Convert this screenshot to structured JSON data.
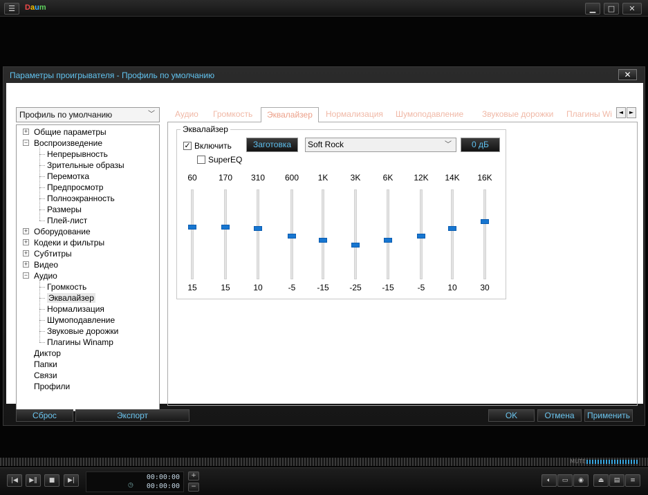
{
  "app": {
    "logo": "Daum",
    "window_icon": "menu-icon",
    "window_buttons": [
      "minimize-icon",
      "restore-icon",
      "close-icon"
    ]
  },
  "dialog": {
    "title": "Параметры проигрывателя - Профиль по умолчанию",
    "close_label": "✕",
    "profile_select": "Профиль по умолчанию",
    "tree": [
      {
        "label": "Общие параметры",
        "level": 0,
        "expander": "+"
      },
      {
        "label": "Воспроизведение",
        "level": 0,
        "expander": "−"
      },
      {
        "label": "Непрерывность",
        "level": 1
      },
      {
        "label": "Зрительные образы",
        "level": 1
      },
      {
        "label": "Перемотка",
        "level": 1
      },
      {
        "label": "Предпросмотр",
        "level": 1
      },
      {
        "label": "Полноэкранность",
        "level": 1
      },
      {
        "label": "Размеры",
        "level": 1
      },
      {
        "label": "Плей-лист",
        "level": 1
      },
      {
        "label": "Оборудование",
        "level": 0,
        "expander": "+"
      },
      {
        "label": "Кодеки и фильтры",
        "level": 0,
        "expander": "+"
      },
      {
        "label": "Субтитры",
        "level": 0,
        "expander": "+"
      },
      {
        "label": "Видео",
        "level": 0,
        "expander": "+"
      },
      {
        "label": "Аудио",
        "level": 0,
        "expander": "−"
      },
      {
        "label": "Громкость",
        "level": 1
      },
      {
        "label": "Эквалайзер",
        "level": 1,
        "selected": true
      },
      {
        "label": "Нормализация",
        "level": 1
      },
      {
        "label": "Шумоподавление",
        "level": 1
      },
      {
        "label": "Звуковые дорожки",
        "level": 1
      },
      {
        "label": "Плагины Winamp",
        "level": 1
      },
      {
        "label": "Диктор",
        "level": 0
      },
      {
        "label": "Папки",
        "level": 0
      },
      {
        "label": "Связи",
        "level": 0
      },
      {
        "label": "Профили",
        "level": 0
      }
    ],
    "tabs": [
      "Аудио",
      "Громкость",
      "Эквалайзер",
      "Нормализация",
      "Шумоподавление",
      "Звуковые дорожки",
      "Плагины Wi"
    ],
    "active_tab": "Эквалайзер",
    "tab_nav": [
      "◄",
      "►"
    ],
    "equalizer": {
      "group_label": "Эквалайзер",
      "enable_label": "Включить",
      "enable_checked": true,
      "supereq_label": "SuperEQ",
      "supereq_checked": false,
      "preset_button": "Заготовка",
      "preset_value": "Soft Rock",
      "preamp_button": "0 дБ",
      "bands": [
        {
          "freq": "60",
          "gain": "15"
        },
        {
          "freq": "170",
          "gain": "15"
        },
        {
          "freq": "310",
          "gain": "10"
        },
        {
          "freq": "600",
          "gain": "-5"
        },
        {
          "freq": "1K",
          "gain": "-15"
        },
        {
          "freq": "3K",
          "gain": "-25"
        },
        {
          "freq": "6K",
          "gain": "-15"
        },
        {
          "freq": "12K",
          "gain": "-5"
        },
        {
          "freq": "14K",
          "gain": "10"
        },
        {
          "freq": "16K",
          "gain": "30"
        }
      ],
      "slider_positions": [
        0.42,
        0.42,
        0.44,
        0.52,
        0.57,
        0.62,
        0.57,
        0.52,
        0.44,
        0.36
      ]
    },
    "buttons": {
      "reset": "Сброс",
      "export": "Экспорт",
      "ok": "OK",
      "cancel": "Отмена",
      "apply": "Применить"
    }
  },
  "player": {
    "mute_label": "MUTE",
    "time_current": "00:00:00",
    "time_total": "00:00:00",
    "volume_level": 1.0
  }
}
